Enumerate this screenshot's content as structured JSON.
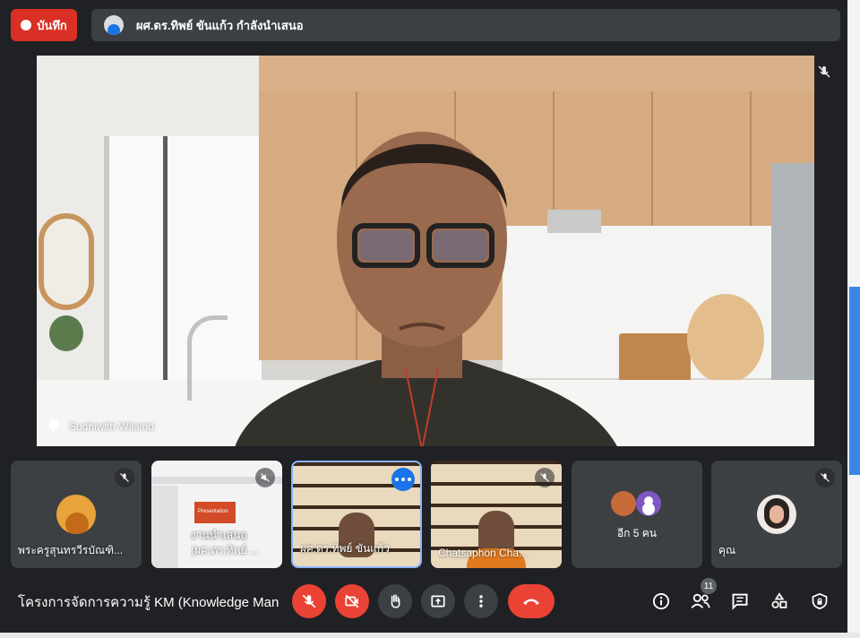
{
  "recording": {
    "label": "บันทึก",
    "icon": "record-dot-icon"
  },
  "presenter": {
    "text": "ผศ.ดร.ทิพย์ ขันแก้ว กำลังนำเสนอ"
  },
  "main_video": {
    "participant_name": "Sudhiwith Wilairid",
    "muted": true,
    "pinned": true
  },
  "tiles": [
    {
      "name": "พระครูสุนทรวีรบัณฑิ...",
      "muted": true,
      "type": "avatar"
    },
    {
      "name": "(ผศ.ดร.ทิพย์ ...",
      "muted": true,
      "type": "screen-share",
      "overlay": "งานนำเสนอ",
      "slide_text": "Presentation"
    },
    {
      "name": "ผศ.ดร.ทิพย์ ขันแก้ว",
      "muted": false,
      "type": "video",
      "active": true
    },
    {
      "name": "Chatsaphon Cha...",
      "muted": true,
      "type": "video"
    },
    {
      "name": "อีก 5 คน",
      "type": "overflow"
    },
    {
      "name": "คุณ",
      "muted": true,
      "type": "avatar"
    }
  ],
  "bottom_bar": {
    "meeting_title": "โครงการจัดการความรู้ KM (Knowledge Man...",
    "participant_count": "11",
    "controls": [
      "mic-off",
      "camera-off",
      "raise-hand",
      "present",
      "more-options",
      "end-call"
    ],
    "right_icons": [
      "info",
      "people",
      "chat",
      "activities",
      "host-controls"
    ]
  },
  "colors": {
    "background": "#202124",
    "danger": "#ea4335",
    "accent": "#1a73e8",
    "tile": "#3c4043"
  }
}
